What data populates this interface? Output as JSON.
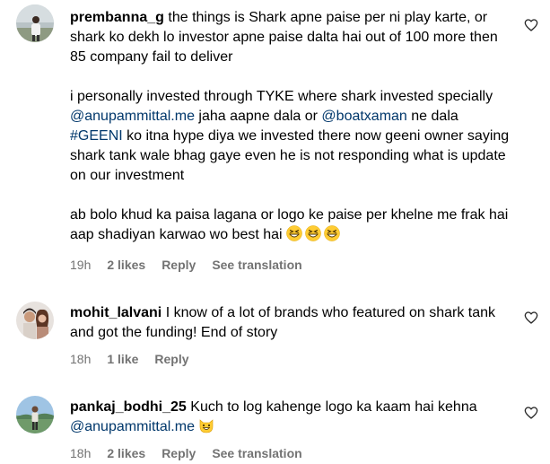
{
  "comments": [
    {
      "username": "prembanna_g",
      "text_p1": "the things is Shark apne paise per ni play karte, or shark ko dekh lo investor apne paise dalta hai out of 100 more then 85 company fail to deliver",
      "text_p2_a": "i personally invested through TYKE where shark invested specially ",
      "mention_1": "@anupammittal.me",
      "text_p2_b": " jaha aapne dala or ",
      "mention_2": "@boatxaman",
      "text_p2_c": " ne dala ",
      "hashtag": "#GEENI",
      "text_p2_d": " ko itna hype diya we invested there now geeni owner saying shark tank wale bhag gaye even he is not responding what is update on our investment",
      "text_p3": "ab bolo khud ka paisa lagana or logo ke paise per khelne me frak hai aap shadiyan karwao wo best hai",
      "emojis": [
        "grinning-squinting-face",
        "grinning-squinting-face",
        "grinning-squinting-face"
      ],
      "time": "19h",
      "likes": "2 likes",
      "reply": "Reply",
      "translate": "See translation"
    },
    {
      "username": "mohit_lalvani",
      "text": "I know of a lot of brands who featured on shark tank and got the funding! End of story",
      "time": "18h",
      "likes": "1 like",
      "reply": "Reply"
    },
    {
      "username": "pankaj_bodhi_25",
      "text": "Kuch to log kahenge logo ka kaam hai kehna",
      "mention": "@anupammittal.me",
      "emoji": "grinning-cat-face",
      "time": "18h",
      "likes": "2 likes",
      "reply": "Reply",
      "translate": "See translation"
    }
  ],
  "colors": {
    "link": "#00376b",
    "meta": "#737373",
    "text": "#000000"
  }
}
